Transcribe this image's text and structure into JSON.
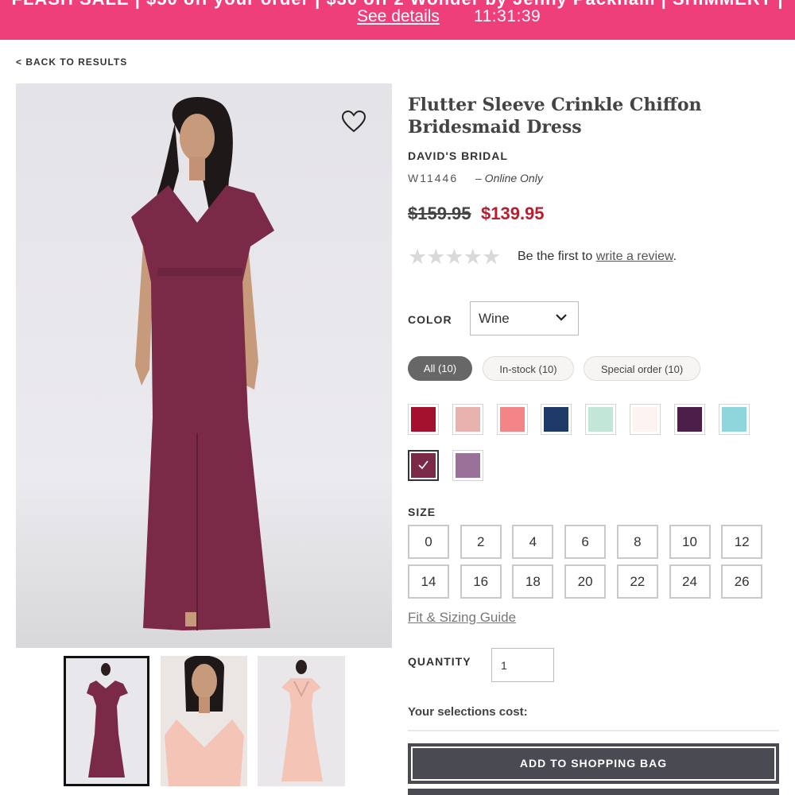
{
  "promo": {
    "headline": "FLASH SALE | $50 off your order | $30 off 2 Wonder by Jenny Packham | SHIMMERY |",
    "details_link": "See details",
    "countdown": "11:31:39"
  },
  "nav": {
    "back_label": "< BACK TO RESULTS"
  },
  "product": {
    "title": "Flutter Sleeve Crinkle Chiffon Bridesmaid Dress",
    "brand": "DAVID'S BRIDAL",
    "sku": "W11446",
    "availability": "– Online Only",
    "price_original": "$159.95",
    "price_sale": "$139.95"
  },
  "reviews": {
    "stars": "★★★★★",
    "rating": 0,
    "prompt": "Be the first to ",
    "link": "write a review",
    "suffix": "."
  },
  "color": {
    "label": "COLOR",
    "selected": "Wine",
    "filters": [
      "All (10)",
      "In-stock (10)",
      "Special order (10)"
    ],
    "active_filter": "All (10)",
    "swatches": [
      "#a3112e",
      "#e8b2ae",
      "#f38586",
      "#1e3a67",
      "#c2e7d8",
      "#fdf3f1",
      "#4c1e4a",
      "#8fd6dc",
      "#7a2a46",
      "#9a7198"
    ],
    "selected_swatch": "#7a2a46"
  },
  "size": {
    "label": "SIZE",
    "options": [
      "0",
      "2",
      "4",
      "6",
      "8",
      "10",
      "12",
      "14",
      "16",
      "18",
      "20",
      "22",
      "24",
      "26"
    ],
    "guide_link": "Fit & Sizing Guide"
  },
  "quantity": {
    "label": "QUANTITY",
    "value": "1"
  },
  "cost_label": "Your selections cost:",
  "add_to_bag": "ADD TO SHOPPING BAG",
  "colors": {
    "promo": "#ee3f7a",
    "sale": "#b51f2e",
    "dress": "#7a2a46",
    "button": "#4a4a52"
  },
  "icons": [
    "heart-icon",
    "chevron-down-icon",
    "check-icon",
    "star-icon"
  ]
}
